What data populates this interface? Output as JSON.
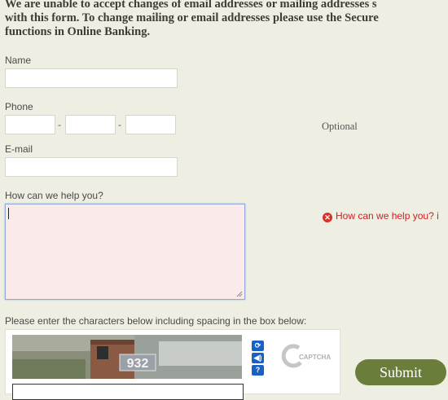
{
  "notice": {
    "line1": "We are unable to accept changes of email addresses or mailing addresses s",
    "line2": "with this form. To change mailing or email addresses please use the Secure",
    "line3": "functions in Online Banking."
  },
  "form": {
    "name_label": "Name",
    "phone_label": "Phone",
    "phone_separator": "-",
    "phone_hint": "Optional",
    "email_label": "E-mail",
    "help_label": "How can we help you?",
    "help_error": "How can we help you? i",
    "captcha_instruction": "Please enter the characters below including spacing in the box below:",
    "captcha_image_text": "932",
    "captcha_brand": "CAPTCHA",
    "submit_label": "Submit"
  },
  "icons": {
    "error": "error-x-icon",
    "refresh": "refresh-icon",
    "audio": "audio-icon",
    "help": "help-icon"
  },
  "colors": {
    "background": "#eeeee2",
    "error": "#d11f1f",
    "submit_bg": "#6b7d3b",
    "captcha_buttons": "#1a61c4",
    "textarea_bg": "#fbeaea"
  }
}
